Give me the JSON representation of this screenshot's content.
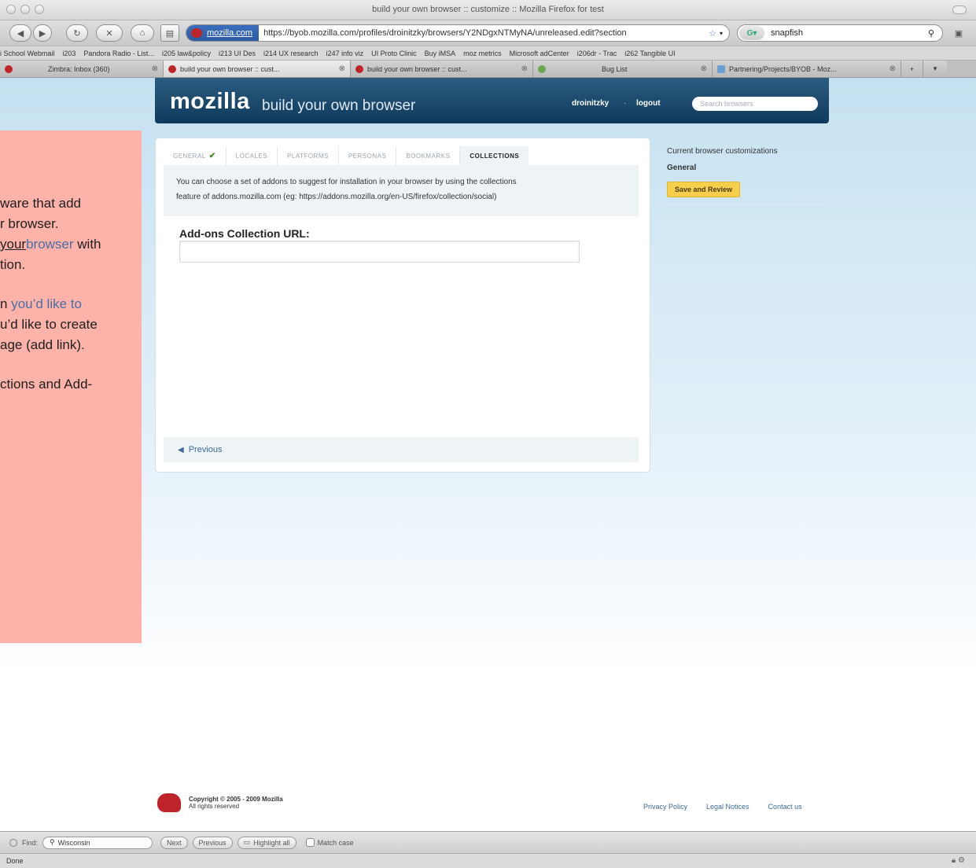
{
  "window": {
    "title": "build your own browser :: customize :: Mozilla Firefox for test"
  },
  "toolbar": {
    "site_identity": "mozilla.com",
    "url": "https://byob.mozilla.com/profiles/droinitzky/browsers/Y2NDgxNTMyNA/unreleased.edit?section",
    "search_value": "snapfish"
  },
  "bookmarks": [
    "i School Webmail",
    "i203",
    "Pandora Radio - List...",
    "i205 law&policy",
    "i213 UI Des",
    "i214 UX research",
    "i247 info viz",
    "UI Proto Clinic",
    "Buy iMSA",
    "moz metrics",
    "Microsoft adCenter",
    "i206dr - Trac",
    "i262 Tangible UI"
  ],
  "tabs": [
    {
      "label": "Zimbra: Inbox (360)"
    },
    {
      "label": "build your own browser :: cust..."
    },
    {
      "label": "build your own browser :: cust..."
    },
    {
      "label": "Bug List"
    },
    {
      "label": "Partnering/Projects/BYOB - Moz..."
    }
  ],
  "header": {
    "logo": "mozilla",
    "subtitle": "build your own browser",
    "username": "droinitzky",
    "separator": "·",
    "logout": "logout",
    "search_placeholder": "Search browsers"
  },
  "panel": {
    "tabs": [
      {
        "label": "GENERAL",
        "check": "✔"
      },
      {
        "label": "LOCALES"
      },
      {
        "label": "PLATFORMS"
      },
      {
        "label": "PERSONAS"
      },
      {
        "label": "BOOKMARKS"
      },
      {
        "label": "COLLECTIONS"
      }
    ],
    "info_line1": "You can choose a set of addons to suggest for installation in your browser by using the collections",
    "info_line2": "feature of addons.mozilla.com (eg: https://addons.mozilla.org/en-US/firefox/collection/social)",
    "field_label": "Add-ons Collection URL:",
    "field_value": "",
    "previous": "Previous"
  },
  "sidebar": {
    "title": "Current browser customizations",
    "general": "General",
    "save_button": "Save and Review"
  },
  "note": {
    "line1": "ware that add",
    "line2": "r browser.",
    "line3a": "your",
    "line3b": "browser",
    "line3c": " with",
    "line4": "tion.",
    "line5a": "n",
    "line5b": " you’d like to",
    "line6": "u’d like to create",
    "line7": "age (add link).",
    "line8": "ctions and Add-"
  },
  "footer": {
    "copyright_line1": "Copyright © 2005 - 2009 Mozilla",
    "copyright_line2": "All rights reserved",
    "links": [
      "Privacy Policy",
      "Legal Notices",
      "Contact us"
    ]
  },
  "findbar": {
    "label": "Find:",
    "value": "Wisconsin",
    "next": "Next",
    "previous": "Previous",
    "highlight": "Highlight all",
    "match_case": "Match case"
  },
  "status": {
    "text": "Done"
  }
}
